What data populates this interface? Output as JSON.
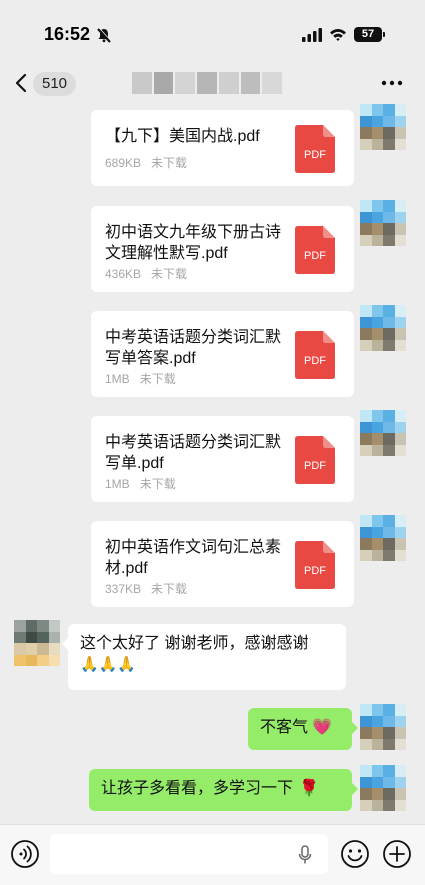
{
  "status": {
    "time": "16:52",
    "battery": "57"
  },
  "nav": {
    "unread": "510"
  },
  "files": [
    {
      "name": "【九下】美国内战.pdf",
      "size": "689KB",
      "state": "未下载",
      "icon_text": "PDF"
    },
    {
      "name": "初中语文九年级下册古诗文理解性默写.pdf",
      "size": "436KB",
      "state": "未下载",
      "icon_text": "PDF"
    },
    {
      "name": "中考英语话题分类词汇默写单答案.pdf",
      "size": "1MB",
      "state": "未下载",
      "icon_text": "PDF"
    },
    {
      "name": "中考英语话题分类词汇默写单.pdf",
      "size": "1MB",
      "state": "未下载",
      "icon_text": "PDF"
    },
    {
      "name": "初中英语作文词句汇总素材.pdf",
      "size": "337KB",
      "state": "未下载",
      "icon_text": "PDF"
    }
  ],
  "messages": [
    {
      "from": "other",
      "text": "这个太好了 谢谢老师，感谢感谢",
      "emoji": "🙏🙏🙏"
    },
    {
      "from": "me",
      "text": "不客气",
      "emoji": "💗"
    },
    {
      "from": "me",
      "text": "让孩子多看看，多学习一下",
      "emoji": "🌹"
    }
  ],
  "colors": {
    "background": "#ededed",
    "out_bubble": "#95ec69",
    "pdf_red": "#e84a43",
    "meta_gray": "#a6a6a6"
  },
  "icons": [
    "bell-muted-icon",
    "signal-icon",
    "wifi-icon",
    "back-icon",
    "more-icon",
    "pdf-file-icon",
    "voice-icon",
    "mic-icon",
    "emoji-icon",
    "plus-icon"
  ]
}
